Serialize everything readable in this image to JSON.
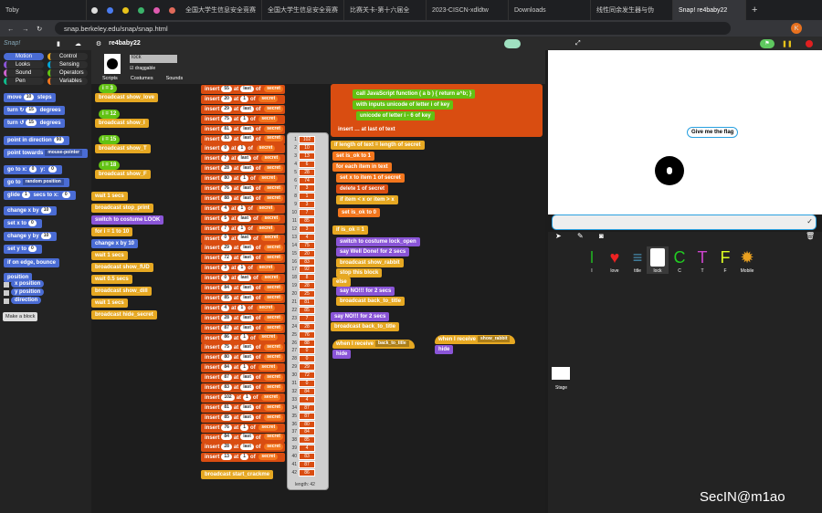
{
  "browser": {
    "tabs": [
      "Toby",
      "全国大学生信息安全竞赛",
      "全国大学生信息安全竞赛",
      "比赛关卡-第十六届全",
      "2023-CISCN-xdldtw",
      "Downloads",
      "线性同余发生器与伪",
      "Snap! re4baby22"
    ],
    "url": "snap.berkeley.edu/snap/snap.html",
    "avatar": "K"
  },
  "snap": {
    "project": "re4baby22",
    "logo": "Snap!"
  },
  "palette": {
    "categories": [
      "Motion",
      "Looks",
      "Sound",
      "Pen",
      "Control",
      "Sensing",
      "Operators",
      "Variables"
    ],
    "blocks": [
      {
        "t": "move",
        "a": "10",
        "b": "steps"
      },
      {
        "t": "turn ↻",
        "a": "15",
        "b": "degrees"
      },
      {
        "t": "turn ↺",
        "a": "15",
        "b": "degrees"
      },
      {
        "t": "point in direction",
        "a": "90"
      },
      {
        "t": "point towards",
        "d": "mouse-pointer"
      },
      {
        "t": "go to x:",
        "a": "0",
        "b": "y:",
        "c": "0"
      },
      {
        "t": "go to",
        "d": "random position"
      },
      {
        "t": "glide",
        "a": "1",
        "b": "secs to x:",
        "c": "0"
      },
      {
        "t": "change x by",
        "a": "10"
      },
      {
        "t": "set x to",
        "a": "0"
      },
      {
        "t": "change y by",
        "a": "10"
      },
      {
        "t": "set y to",
        "a": "0"
      },
      {
        "t": "if on edge, bounce"
      },
      {
        "t": "position"
      }
    ],
    "reporters": [
      "x position",
      "y position",
      "direction"
    ],
    "make_block": "Make a block"
  },
  "sprite": {
    "name": "lock",
    "draggable": "draggable",
    "tabs": [
      "Scripts",
      "Costumes",
      "Sounds"
    ]
  },
  "scripts": {
    "left_blocks": [
      "broadcast show_love",
      "broadcast show_I",
      "broadcast show_T",
      "broadcast show_F",
      "wait 1 secs",
      "broadcast stop_print",
      "switch to costume LOOK",
      "for i = 1 to 10",
      "change x by 10",
      "wait 1 secs",
      "broadcast show_fUD",
      "wait 0.5 secs",
      "broadcast show_dill",
      "wait 1 secs",
      "broadcast hide_secret"
    ],
    "conditions": [
      "i = 3",
      "i = 12",
      "i = 15",
      "i = 18"
    ],
    "inserts": [
      [
        "55",
        "last"
      ],
      [
        "20",
        "1"
      ],
      [
        "29",
        "last"
      ],
      [
        "75",
        "1"
      ],
      [
        "81",
        "last"
      ],
      [
        "83",
        "last"
      ],
      [
        "0",
        "1"
      ],
      [
        "7",
        "last"
      ],
      [
        "28",
        "last"
      ],
      [
        "80",
        "1"
      ],
      [
        "76",
        "last"
      ],
      [
        "88",
        "last"
      ],
      [
        "4",
        "1"
      ],
      [
        "5",
        "last"
      ],
      [
        "7",
        "1"
      ],
      [
        "0",
        "last"
      ],
      [
        "29",
        "last"
      ],
      [
        "72",
        "last"
      ],
      [
        "3",
        "1"
      ],
      [
        "0",
        "last"
      ],
      [
        "84",
        "last"
      ],
      [
        "85",
        "last"
      ],
      [
        "4",
        "1"
      ],
      [
        "28",
        "last"
      ],
      [
        "87",
        "last"
      ],
      [
        "86",
        "1"
      ],
      [
        "75",
        "last"
      ],
      [
        "80",
        "last"
      ],
      [
        "84",
        "1"
      ],
      [
        "87",
        "last"
      ],
      [
        "83",
        "last"
      ],
      [
        "102",
        "1"
      ],
      [
        "81",
        "last"
      ],
      [
        "85",
        "last"
      ],
      [
        "76",
        "1"
      ],
      [
        "84",
        "last"
      ],
      [
        "28",
        "last"
      ],
      [
        "13",
        "1"
      ]
    ],
    "insert_words": [
      "insert",
      "at",
      "of",
      "secret"
    ],
    "final_broadcast": "broadcast start_crackme",
    "right": [
      "call JavaScript function ( a b ) { return a^b; }",
      "with inputs unicode of letter i of key",
      "unicode of letter i - 6 of key",
      "insert … at last of text",
      "if length of text = length of secret",
      "set is_ok to 1",
      "for each item in text",
      "set x to item 1 of secret",
      "delete 1 of secret",
      "if item < x or item > x",
      "set is_ok to 0",
      "if is_ok = 1",
      "switch to costume lock_open",
      "say Well Done! for 2 secs",
      "broadcast show_rabbit",
      "stop this block",
      "else",
      "say NO!!! for 2 secs",
      "broadcast back_to_title",
      "say NO!!! for 2 secs",
      "broadcast back_to_title"
    ],
    "hats": [
      {
        "label": "when I receive",
        "msg": "back_to_title",
        "then": "hide"
      },
      {
        "label": "when I receive",
        "msg": "show_rabbit",
        "then": "hide"
      }
    ]
  },
  "list_watcher": {
    "values": [
      "102",
      "10",
      "13",
      "6",
      "28",
      "74",
      "3",
      "1",
      "3",
      "7",
      "85",
      "3",
      "4",
      "75",
      "20",
      "83",
      "92",
      "8",
      "28",
      "25",
      "81",
      "85",
      "7",
      "28",
      "76",
      "88",
      "0",
      "0",
      "29",
      "72",
      "0",
      "84",
      "4",
      "87",
      "87",
      "80",
      "84",
      "85",
      "4",
      "83",
      "87",
      "86"
    ],
    "length_label": "length: 42"
  },
  "stage": {
    "speech": "Give me the flag"
  },
  "corral": {
    "sprites": [
      "I",
      "love",
      "title",
      "lock",
      "C",
      "T",
      "F",
      "Mobile"
    ],
    "stage_label": "Stage"
  },
  "watermark": "SecIN@m1ao"
}
